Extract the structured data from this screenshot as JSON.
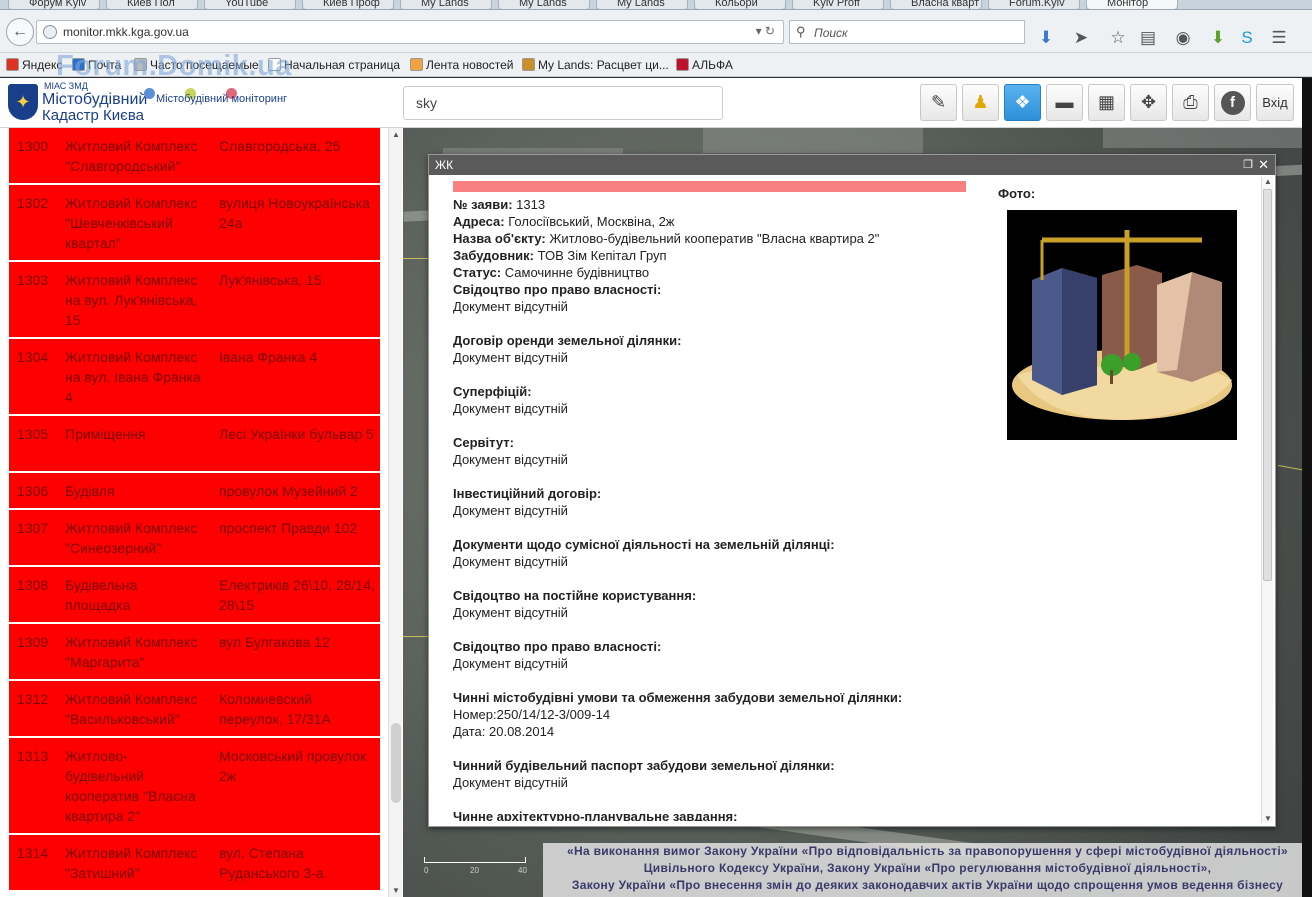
{
  "browser": {
    "tabs": [
      "Форум Kyiv",
      "Киев Пол",
      "YouTube",
      "Киев Проф",
      "My Lands",
      "My Lands",
      "My Lands",
      "Кольори",
      "Kyiv Proff",
      "Власна кварт",
      "Forum.Kyiv",
      "Монітор"
    ],
    "url": "monitor.mkk.kga.gov.ua",
    "search_placeholder": "Поиск",
    "bookmarks": [
      "Яндекс",
      "Почта",
      "Часто посещаемые",
      "Начальная страница",
      "Лента новостей",
      "My Lands: Расцвет ци...",
      "АЛЬФА"
    ]
  },
  "watermark": "Forum.Domik.ua",
  "app": {
    "logo_top": "МІАС ЗМД",
    "logo_line1": "Містобудівний",
    "logo_line2": "Кадастр Києва",
    "logo_sub": "Містобудівний моніторинг",
    "search_value": "sky",
    "exit_label": "Вхід",
    "dot_colors": [
      "#5b8fd6",
      "#c9d45e",
      "#e06a7a"
    ]
  },
  "sidebar": {
    "rows": [
      {
        "id": "1300",
        "name": "Житловий Комплекс \"Славгородський\"",
        "address": "Славгородська, 25"
      },
      {
        "id": "1302",
        "name": "Житловий Комплекс \"Шевченківський квартал\"",
        "address": "вулиця Новоукраїнська 24а"
      },
      {
        "id": "1303",
        "name": "Житловий Комплекс на вул. Лук'янівська, 15",
        "address": "Лук'янівська, 15"
      },
      {
        "id": "1304",
        "name": "Житловий Комплекс на вул. Івана Франка 4",
        "address": "Івана Франка 4"
      },
      {
        "id": "1305",
        "name": "Приміщення",
        "address": "Лесі Українки бульвар 5"
      },
      {
        "id": "1306",
        "name": "Будівля",
        "address": "провулок Музейний 2"
      },
      {
        "id": "1307",
        "name": "Житловий Комплекс \"Синеозерний\"",
        "address": "проспект Правди 102"
      },
      {
        "id": "1308",
        "name": "Будівельна площадка",
        "address": "Електриків 26\\10, 28/14, 28\\15"
      },
      {
        "id": "1309",
        "name": "Житловий Комплекс \"Маргарита\"",
        "address": "вул Булгакова 12"
      },
      {
        "id": "1312",
        "name": "Житловий Комплекс \"Васильковський\"",
        "address": "Коломиевский переулок, 17/31А"
      },
      {
        "id": "1313",
        "name": "Житлово-будівельний кооператив \"Власна квартира 2\"",
        "address": "Московський провулок 2ж"
      },
      {
        "id": "1314",
        "name": "Житловий Комплекс \"Затишний\"",
        "address": "вул. Степана Руданського 3-а"
      }
    ]
  },
  "popup": {
    "title": "ЖК",
    "photo_label": "Фото:",
    "fields": [
      {
        "label": "№ заяви:",
        "value": "1313"
      },
      {
        "label": "Адреса:",
        "value": "Голосіївський, Москвіна, 2ж"
      },
      {
        "label": "Назва об'єкту:",
        "value": "Житлово-будівельний кооператив \"Власна квартира 2\""
      },
      {
        "label": "Забудовник:",
        "value": "ТОВ Зім Кепітал Груп"
      },
      {
        "label": "Статус:",
        "value": "Самочинне будівництво"
      }
    ],
    "docs": [
      {
        "label": "Свідоцтво про право власності:",
        "value": "Документ відсутній"
      },
      {
        "label": "Договір оренди земельної ділянки:",
        "value": "Документ відсутній"
      },
      {
        "label": "Суперфіцій:",
        "value": "Документ відсутній"
      },
      {
        "label": "Сервітут:",
        "value": "Документ відсутній"
      },
      {
        "label": "Інвестиційний договір:",
        "value": "Документ відсутній"
      },
      {
        "label": "Документи щодо сумісної діяльності на земельній ділянці:",
        "value": "Документ відсутній"
      },
      {
        "label": "Свідоцтво на постійне користування:",
        "value": "Документ відсутній"
      },
      {
        "label": "Свідоцтво про право власності:",
        "value": "Документ відсутній"
      }
    ],
    "conditions": {
      "label": "Чинні містобудівні умови та обмеження забудови земельної ділянки:",
      "number": "Номер:250/14/12-3/009-14",
      "date": "Дата:  20.08.2014"
    },
    "passport": {
      "label": "Чинний будівельний паспорт забудови земельної ділянки:",
      "value": "Документ відсутній"
    },
    "last_label": "Чинне архітектурно-планувальне завдання:"
  },
  "map": {
    "scale_left": "0",
    "scale_mid": "20",
    "scale_right": "40"
  },
  "footer": {
    "line1": "«На виконання вимог Закону України «Про відповідальність за правопорушення у сфері містобудівної діяльності»",
    "line2": "Цивільного Кодексу України, Закону України «Про регулювання містобудівної діяльності»,",
    "line3": "Закону України «Про внесення змін до деяких законодавчих актів України щодо спрощення умов ведення бізнесу"
  }
}
